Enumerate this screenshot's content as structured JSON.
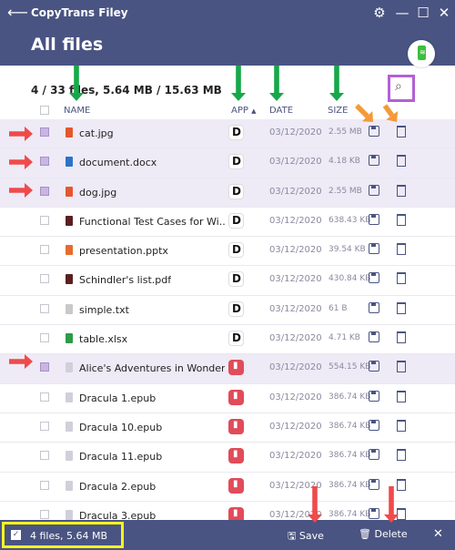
{
  "app": {
    "title": "CopyTrans Filey",
    "back_icon": "arrow-left-icon",
    "page_title": "All files",
    "window_controls": {
      "settings": "⚙",
      "minimize": "—",
      "maximize": "☐",
      "close": "✕"
    }
  },
  "summary": "4 / 33 files, 5.64 MB / 15.63 MB",
  "columns": {
    "name": "NAME",
    "app": "APP",
    "date": "DATE",
    "size": "SIZE"
  },
  "sort_indicator": "▲",
  "files": [
    {
      "name": "cat.jpg",
      "app": "docs",
      "date": "03/12/2020",
      "size": "2.55 MB",
      "selected": true,
      "type": "jpg"
    },
    {
      "name": "document.docx",
      "app": "docs",
      "date": "03/12/2020",
      "size": "4.18 KB",
      "selected": true,
      "type": "docx"
    },
    {
      "name": "dog.jpg",
      "app": "docs",
      "date": "03/12/2020",
      "size": "2.55 MB",
      "selected": true,
      "type": "jpg"
    },
    {
      "name": "Functional Test Cases for Wi...",
      "app": "docs",
      "date": "03/12/2020",
      "size": "638.43 KB",
      "selected": false,
      "type": "pdf"
    },
    {
      "name": "presentation.pptx",
      "app": "docs",
      "date": "03/12/2020",
      "size": "39.54 KB",
      "selected": false,
      "type": "pptx"
    },
    {
      "name": "Schindler's list.pdf",
      "app": "docs",
      "date": "03/12/2020",
      "size": "430.84 KB",
      "selected": false,
      "type": "pdf"
    },
    {
      "name": "simple.txt",
      "app": "docs",
      "date": "03/12/2020",
      "size": "61 B",
      "selected": false,
      "type": "txt"
    },
    {
      "name": "table.xlsx",
      "app": "docs",
      "date": "03/12/2020",
      "size": "4.71 KB",
      "selected": false,
      "type": "xlsx"
    },
    {
      "name": "Alice's Adventures in Wonder...",
      "app": "books",
      "date": "03/12/2020",
      "size": "554.15 KB",
      "selected": true,
      "type": "epub"
    },
    {
      "name": "Dracula 1.epub",
      "app": "books",
      "date": "03/12/2020",
      "size": "386.74 KB",
      "selected": false,
      "type": "epub"
    },
    {
      "name": "Dracula 10.epub",
      "app": "books",
      "date": "03/12/2020",
      "size": "386.74 KB",
      "selected": false,
      "type": "epub"
    },
    {
      "name": "Dracula 11.epub",
      "app": "books",
      "date": "03/12/2020",
      "size": "386.74 KB",
      "selected": false,
      "type": "epub"
    },
    {
      "name": "Dracula 2.epub",
      "app": "books",
      "date": "03/12/2020",
      "size": "386.74 KB",
      "selected": false,
      "type": "epub"
    },
    {
      "name": "Dracula 3.epub",
      "app": "books",
      "date": "03/12/2020",
      "size": "386.74 KB",
      "selected": false,
      "type": "epub"
    }
  ],
  "footer": {
    "selection": "4 files, 5.64 MB",
    "save_label": "Save",
    "delete_label": "Delete",
    "close": "✕"
  },
  "colors": {
    "header_bg": "#4a5482",
    "highlight_purple": "#b45fd6",
    "highlight_yellow": "#f7f320",
    "arrow_green": "#17a84a",
    "arrow_red": "#ef4b4b",
    "arrow_orange": "#f39a3a"
  },
  "annotations": {
    "arrow_colors": [
      "green",
      "red",
      "orange"
    ]
  }
}
